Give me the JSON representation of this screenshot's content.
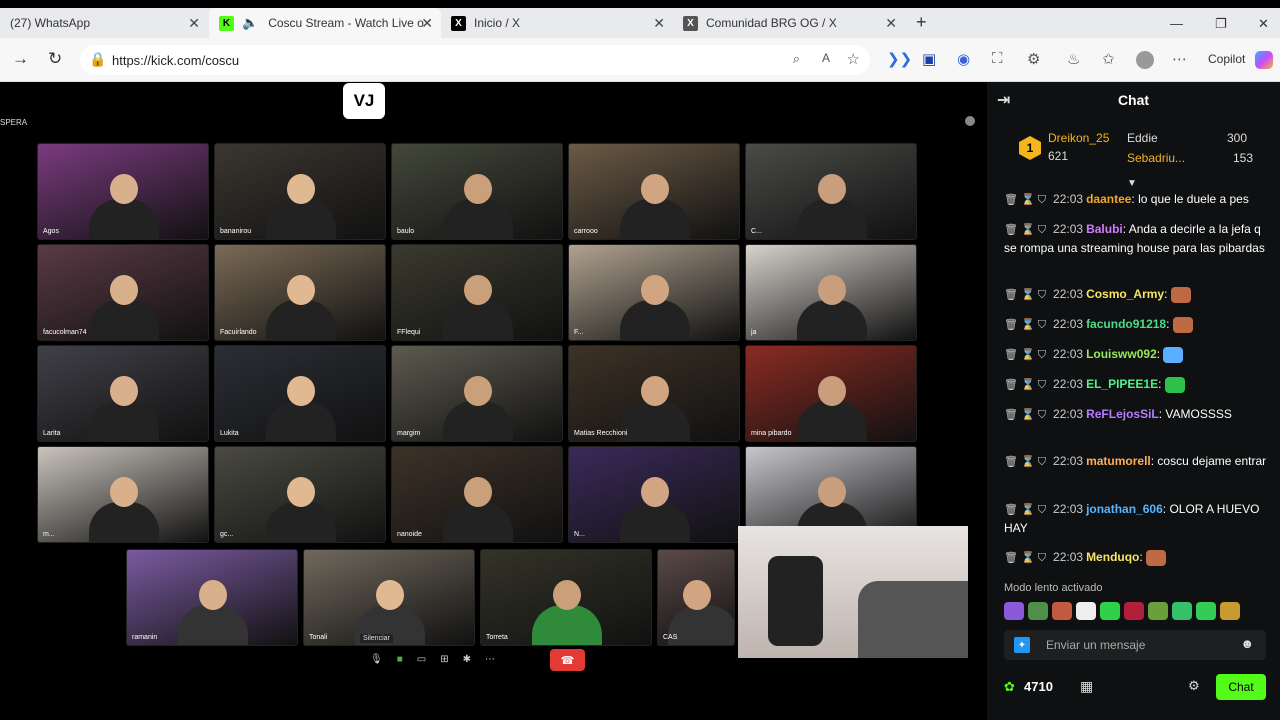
{
  "browser": {
    "tabs": [
      {
        "label": "(27) WhatsApp",
        "icon": "whatsapp-icon"
      },
      {
        "label": "Coscu Stream - Watch Live o",
        "icon": "kick-icon"
      },
      {
        "label": "Inicio / X",
        "icon": "x-icon"
      },
      {
        "label": "Comunidad BRG OG / X",
        "icon": "x-icon"
      }
    ],
    "new_tab": "+",
    "url": "https://kick.com/coscu",
    "copilot": "Copilot"
  },
  "stream": {
    "logo": "VJ",
    "espera": "SPERA",
    "participants": [
      "Agos",
      "bananirou",
      "baulo",
      "carrooo",
      "C...",
      "facucolman74",
      "Facuirlando",
      "FFlequi",
      "F...",
      "ja",
      "Larita",
      "Lukita",
      "margim",
      "Matias Recchioni",
      "mina pibardo",
      "m...",
      "gc...",
      "nanoide",
      "N...",
      "",
      "ramanin",
      "Tonali",
      "Torreta",
      "CAS"
    ],
    "silenciar": "Silenciar"
  },
  "chat": {
    "title": "Chat",
    "leaderboard": {
      "rank": "1",
      "first_name": "Dreikon_25",
      "first_value": "621",
      "second_name": "Eddie",
      "second_value": "300",
      "third_name": "Sebadriu...",
      "third_value": "153"
    },
    "messages": [
      {
        "time": "22:03",
        "user": "daantee",
        "color": "#f5a623",
        "text": "lo que le duele a pes"
      },
      {
        "time": "22:03",
        "user": "Balubi",
        "color": "#d07cff",
        "text": "Anda a decirle a la jefa q se rompa una streaming house para las pibardas"
      },
      {
        "time": "22:03",
        "user": "Cosmo_Army",
        "color": "#f5e663",
        "text": ""
      },
      {
        "time": "22:03",
        "user": "facundo91218",
        "color": "#4ddb8a",
        "text": ""
      },
      {
        "time": "22:03",
        "user": "Louisww092",
        "color": "#9ae85a",
        "text": ""
      },
      {
        "time": "22:03",
        "user": "EL_PIPEE1E",
        "color": "#4ff08a",
        "text": ""
      },
      {
        "time": "22:03",
        "user": "ReFLejosSiL",
        "color": "#b57cff",
        "text": "VAMOSSSS"
      },
      {
        "time": "22:03",
        "user": "matumorell",
        "color": "#ffae5a",
        "text": "coscu dejame entrar"
      },
      {
        "time": "22:03",
        "user": "jonathan_606",
        "color": "#5ab4ff",
        "text": "OLOR A HUEVO HAY"
      },
      {
        "time": "22:03",
        "user": "Menduqo",
        "color": "#f5e663",
        "text": ""
      }
    ],
    "slow_mode": "Modo lento activado",
    "placeholder": "Enviar un mensaje",
    "points": "4710",
    "send": "Chat"
  }
}
